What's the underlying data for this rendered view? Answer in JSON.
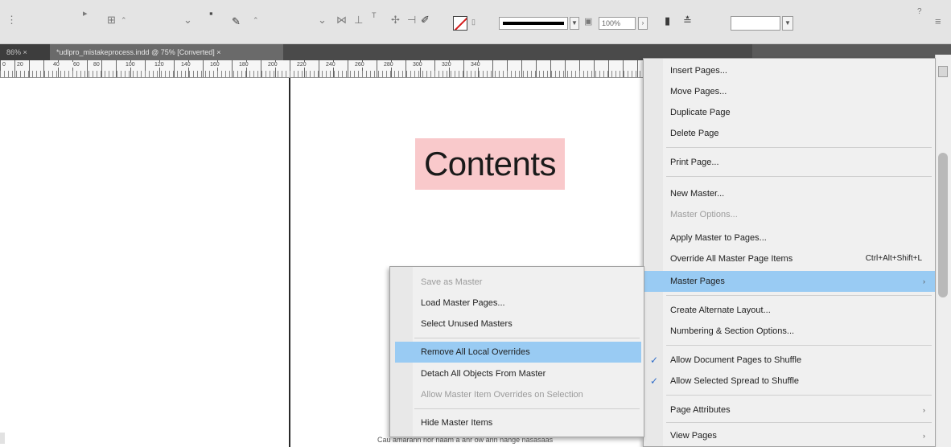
{
  "toolbar": {
    "zoom_value": "100%",
    "fill_swatch_color": "#ffffff",
    "stroke_swatch_color": "#d41a1a",
    "icons": [
      "align-icon",
      "text-frame-icon",
      "fill-swatch-icon",
      "stroke-weight-icon",
      "percent-field",
      "wrap-icon",
      "style-select"
    ]
  },
  "tabs": [
    {
      "label": "86% ×"
    },
    {
      "label": "*udlpro_mistakeprocess.indd @ 75% [Converted] ×"
    }
  ],
  "ruler": {
    "labels": [
      "0",
      "20",
      "40",
      "60",
      "80",
      "100",
      "120",
      "140",
      "160",
      "180",
      "200",
      "220",
      "240",
      "260",
      "280",
      "300",
      "320",
      "340"
    ]
  },
  "document": {
    "heading": "Contents",
    "body_line": "Cau amarann nor naam a anr ow ann nange nasasaas"
  },
  "menu": {
    "items": [
      {
        "label": "Insert Pages...",
        "disabled": false
      },
      {
        "label": "Move Pages...",
        "disabled": false
      },
      {
        "label": "Duplicate Page",
        "disabled": false
      },
      {
        "label": "Delete Page",
        "disabled": false
      },
      {
        "label": "Print Page...",
        "disabled": false
      },
      {
        "label": "New Master...",
        "disabled": false
      },
      {
        "label": "Master Options...",
        "disabled": true
      },
      {
        "label": "Apply Master to Pages...",
        "disabled": false
      },
      {
        "label": "Override All Master Page Items",
        "shortcut": "Ctrl+Alt+Shift+L",
        "disabled": false
      },
      {
        "label": "Master Pages",
        "submenu": true,
        "highlighted": true
      },
      {
        "label": "Create Alternate Layout...",
        "disabled": false
      },
      {
        "label": "Numbering & Section Options...",
        "disabled": false
      },
      {
        "label": "Allow Document Pages to Shuffle",
        "checked": true
      },
      {
        "label": "Allow Selected Spread to Shuffle",
        "checked": true
      },
      {
        "label": "Page Attributes",
        "submenu": true
      },
      {
        "label": "View Pages",
        "submenu": true
      }
    ],
    "submenu_arrow": "›",
    "check_glyph": "✓"
  },
  "submenu": {
    "items": [
      {
        "label": "Save as Master",
        "disabled": true
      },
      {
        "label": "Load Master Pages...",
        "disabled": false
      },
      {
        "label": "Select Unused Masters",
        "disabled": false
      },
      {
        "label": "Remove All Local Overrides",
        "highlighted": true
      },
      {
        "label": "Detach All Objects From Master",
        "disabled": false
      },
      {
        "label": "Allow Master Item Overrides on Selection",
        "disabled": true
      },
      {
        "label": "Hide Master Items",
        "disabled": false
      }
    ]
  },
  "colors": {
    "highlight": "#99cbf3",
    "heading_bg": "#f9c9cb",
    "check": "#2f6cc8"
  }
}
